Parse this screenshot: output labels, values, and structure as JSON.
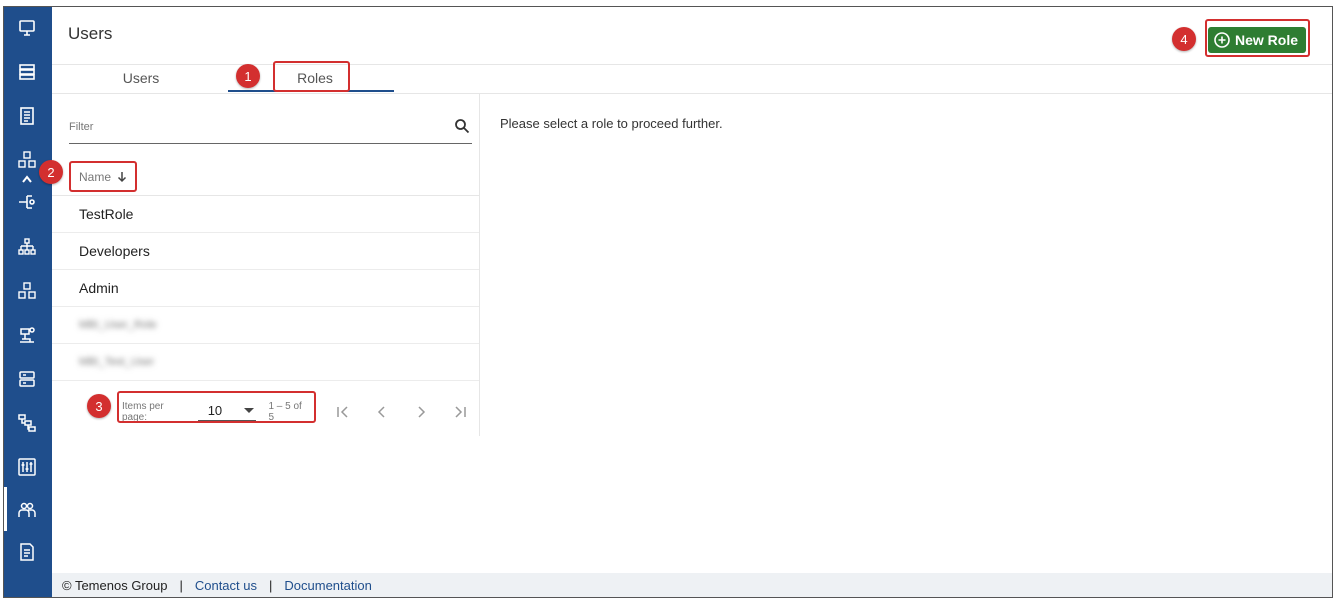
{
  "sidebar": {
    "icons": [
      "monitor-icon",
      "server-list-icon",
      "document-icon",
      "cubes-icon",
      "route-icon",
      "hierarchy-icon",
      "cubes-alt-icon",
      "robot-arm-icon",
      "database-icon",
      "tree-icon",
      "equalizer-icon",
      "users-icon",
      "report-icon"
    ],
    "active": "users-icon"
  },
  "header": {
    "title": "Users",
    "new_role_label": "New Role"
  },
  "tabs": [
    {
      "label": "Users"
    },
    {
      "label": "Roles"
    }
  ],
  "filter": {
    "placeholder": "Filter",
    "value": ""
  },
  "list": {
    "column_header": "Name",
    "rows": [
      "TestRole",
      "Developers",
      "Admin",
      "MBI_User_Role",
      "MBI_Test_User"
    ]
  },
  "pagination": {
    "items_per_page_label": "Items per page:",
    "items_per_page": "10",
    "range": "1 – 5 of 5"
  },
  "detail": {
    "message": "Please select a role to proceed further."
  },
  "footer": {
    "copyright": "© Temenos Group",
    "contact": "Contact us",
    "documentation": "Documentation"
  },
  "callouts": [
    "1",
    "2",
    "3",
    "4"
  ],
  "colors": {
    "sidebar": "#1f4e8c",
    "primary_button": "#2e7d32",
    "annotation": "#d32f2f"
  }
}
